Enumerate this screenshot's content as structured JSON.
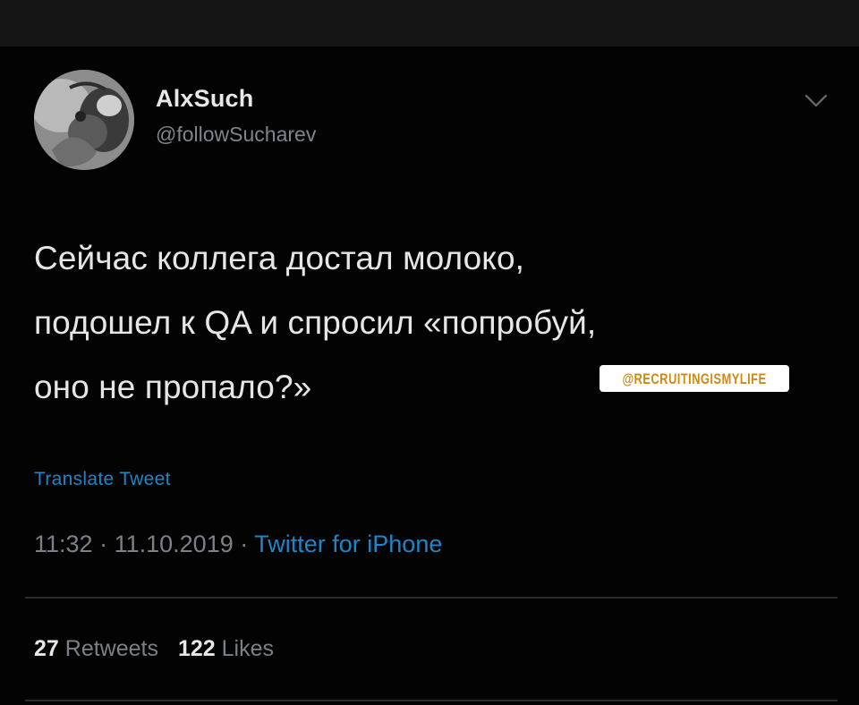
{
  "profile": {
    "display_name": "AlxSuch",
    "handle": "@followSucharev",
    "avatar_icon": "user-avatar-photo"
  },
  "menu": {
    "icon": "chevron-down-icon"
  },
  "tweet": {
    "lines": [
      "Сейчас коллега достал молоко,",
      "подошел к QA и спросил «попробуй,",
      "оно не пропало?»"
    ],
    "translate_label": "Translate Tweet"
  },
  "watermark": {
    "text": "@RECRUITINGISMYLIFE"
  },
  "meta": {
    "time": "11:32",
    "separator": "·",
    "date": "11.10.2019",
    "source": "Twitter for iPhone"
  },
  "stats": {
    "retweets_count": "27",
    "retweets_label": "Retweets",
    "likes_count": "122",
    "likes_label": "Likes"
  },
  "colors": {
    "background": "#030303",
    "text": "#e6e6e6",
    "muted": "#7a8189",
    "link": "#1d86c8",
    "watermark_text": "#d08a12"
  }
}
